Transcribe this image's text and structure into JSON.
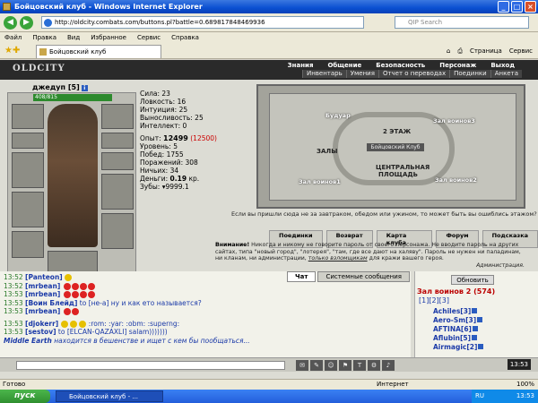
{
  "window": {
    "title": "Бойцовский клуб - Windows Internet Explorer"
  },
  "address": {
    "url": "http://oldcity.combats.com/buttons.pl?battle=0.689817848469936",
    "search_placeholder": "QIP Search"
  },
  "menu": [
    "Файл",
    "Правка",
    "Вид",
    "Избранное",
    "Сервис",
    "Справка"
  ],
  "tab": {
    "title": "Бойцовский клуб"
  },
  "toolbar": {
    "page": "Страница",
    "service": "Сервис"
  },
  "game": {
    "logo": "OLDCITY",
    "topnav": [
      "Знания",
      "Общение",
      "Безопасность",
      "Персонаж",
      "Выход"
    ],
    "subnav": [
      "Инвентарь",
      "Умения",
      "Отчет о переводах",
      "Поединки",
      "Анкета"
    ],
    "nick": "джедуп",
    "level": "[5]",
    "hp": "408/815"
  },
  "stats": {
    "strength": "Сила: 23",
    "agility": "Ловкость: 16",
    "intuition": "Интуиция: 25",
    "stamina": "Выносливость: 25",
    "intellect": "Интеллект: 0",
    "exp_label": "Опыт:",
    "exp_value": "12499",
    "exp_next": "(12500)",
    "level_line": "Уровень: 5",
    "wins": "Побед: 1755",
    "losses": "Поражений: 308",
    "draws": "Ничьих: 34",
    "money_label": "Деньги:",
    "money_value": "0.19",
    "money_unit": "кр.",
    "teeth": "Зубы: ▾9999.1"
  },
  "map": {
    "floor": "2 ЭТАЖ",
    "club": "Бойцовский Клуб",
    "halls": "ЗАЛЫ",
    "central": "ЦЕНТРАЛЬНАЯ ПЛОЩАДЬ",
    "boudoir": "Будуар",
    "hall3": "Зал воинов3",
    "hall1": "Зал воинов1",
    "hall2": "Зал воинов2"
  },
  "riddle": "Если вы пришли сюда не за завтраком, обедом или ужином, то может быть вы ошиблись этажом?",
  "buttons": [
    "Поединки",
    "Возврат",
    "Карта клуба",
    "Форум",
    "Подсказка"
  ],
  "warning": {
    "bold": "Внимание!",
    "text": "Никогда и никому не говорите пароль от своего персонажа. Не вводите пароль на других сайтах, типа \"новый город\", \"лотерея\", \"там, где все дают на халяву\". Пароль не нужен ни паладинам, ни кланам, ни администрации,",
    "link": "только взломщикам",
    "tail": "для кражи вашего героя.",
    "sign": "Администрация."
  },
  "chat": {
    "tabs": [
      "Чат",
      "Системные сообщения"
    ],
    "lines": [
      {
        "time": "13:52",
        "nick": "[Panteon]",
        "text": ""
      },
      {
        "time": "13:52",
        "nick": "[mrbean]",
        "text": ""
      },
      {
        "time": "13:53",
        "nick": "[mrbean]",
        "text": ""
      },
      {
        "time": "13:53",
        "nick": "[Воин Блейд]",
        "text": "to [не-a] ну и как ето называется?"
      },
      {
        "time": "13:53",
        "nick": "[mrbean]",
        "text": ""
      },
      {
        "time": "13:53",
        "nick": "[djokerr]",
        "text": ":rom: :yar: :obm: :superng:"
      },
      {
        "time": "13:53",
        "nick": "[sestov]",
        "text": "to [ELCAN-QAZAXLI] salam)))))))"
      },
      {
        "time": "",
        "nick": "Middle Earth",
        "text": "находится в бешенстве и ищет с кем бы пообщаться..."
      }
    ]
  },
  "online": {
    "refresh": "Обновить",
    "room": "Зал воинов 2 (574)",
    "pages": "[1][2][3]",
    "players": [
      "Achiles[3]",
      "Aero-Sm[3]",
      "AFTINA[6]",
      "Aflubin[5]",
      "Airmagic[2]"
    ]
  },
  "game_clock": "13:53",
  "status": {
    "left": "Готово",
    "internet": "Интернет",
    "zoom": "100%"
  },
  "taskbar": {
    "start": "пуск",
    "task": "Бойцовский клуб - ...",
    "lang": "RU",
    "time": "13:53"
  }
}
